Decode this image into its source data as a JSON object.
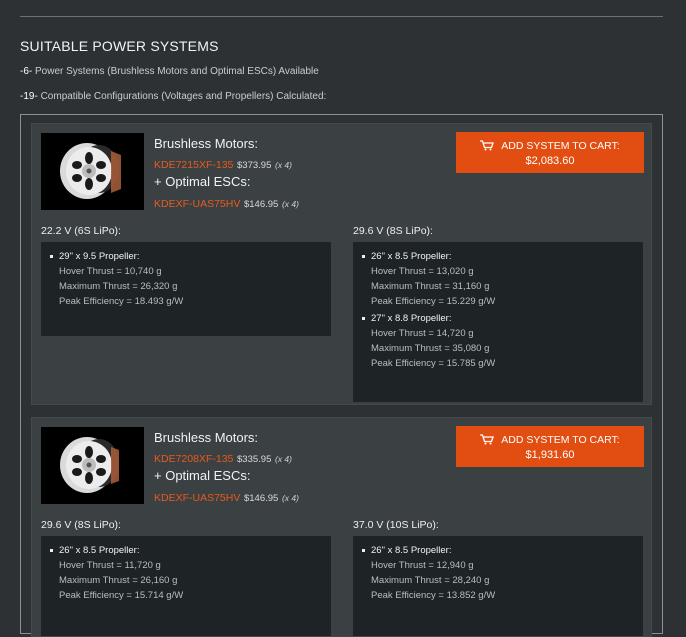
{
  "header": {
    "title": "SUITABLE POWER SYSTEMS",
    "systems_count": "-6-",
    "systems_text": " Power Systems (Brushless Motors and Optimal ESCs) Available",
    "configs_count": "-19-",
    "configs_text": " Compatible Configurations (Voltages and Propellers) Calculated:"
  },
  "labels": {
    "motors_heading": "Brushless Motors:",
    "escs_heading": "+ Optimal ESCs:",
    "add_cart": "ADD SYSTEM TO CART:",
    "hover": "Hover Thrust",
    "max": "Maximum Thrust",
    "eff": "Peak Efficiency"
  },
  "systems": [
    {
      "motor_model": "KDE7215XF-135",
      "motor_price": "$373.95",
      "motor_qty": "(x 4)",
      "esc_model": "KDEXF-UAS75HV",
      "esc_price": "$146.95",
      "esc_qty": "(x 4)",
      "cart_price": "$2,083.60",
      "configs": [
        {
          "voltage": "22.2 V (6S LiPo):",
          "props": [
            {
              "propeller": "29\" x 9.5 Propeller:",
              "hover": "Hover Thrust = 10,740 g",
              "max": "Maximum Thrust = 26,320 g",
              "eff": "Peak Efficiency = 18.493 g/W"
            }
          ]
        },
        {
          "voltage": "29.6 V (8S LiPo):",
          "props": [
            {
              "propeller": "26\" x 8.5 Propeller:",
              "hover": "Hover Thrust = 13,020 g",
              "max": "Maximum Thrust = 31,160 g",
              "eff": "Peak Efficiency = 15.229 g/W"
            },
            {
              "propeller": "27\" x 8.8 Propeller:",
              "hover": "Hover Thrust = 14,720 g",
              "max": "Maximum Thrust = 35,080 g",
              "eff": "Peak Efficiency = 15.785 g/W"
            }
          ]
        }
      ]
    },
    {
      "motor_model": "KDE7208XF-135",
      "motor_price": "$335.95",
      "motor_qty": "(x 4)",
      "esc_model": "KDEXF-UAS75HV",
      "esc_price": "$146.95",
      "esc_qty": "(x 4)",
      "cart_price": "$1,931.60",
      "configs": [
        {
          "voltage": "29.6 V (8S LiPo):",
          "props": [
            {
              "propeller": "26\" x 8.5 Propeller:",
              "hover": "Hover Thrust = 11,720 g",
              "max": "Maximum Thrust = 26,160 g",
              "eff": "Peak Efficiency = 15.714 g/W"
            }
          ]
        },
        {
          "voltage": "37.0 V (10S LiPo):",
          "props": [
            {
              "propeller": "26\" x 8.5 Propeller:",
              "hover": "Hover Thrust = 12,940 g",
              "max": "Maximum Thrust = 28,240 g",
              "eff": "Peak Efficiency = 13.852 g/W"
            }
          ]
        }
      ]
    }
  ],
  "colors": {
    "background": "#2d3133",
    "card": "#3b4043",
    "panel": "#1e2325",
    "accent": "#e85a1c",
    "button": "#e24e12"
  }
}
